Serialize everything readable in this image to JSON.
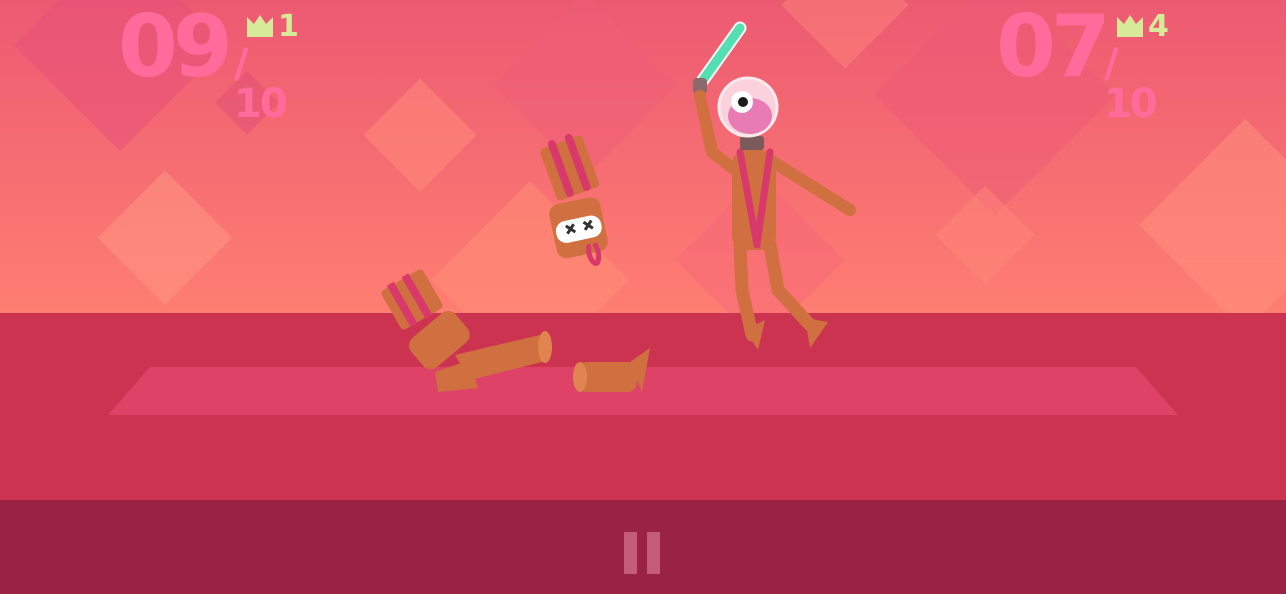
{
  "player1": {
    "score": "09",
    "total": "/ 10",
    "wins": "1"
  },
  "player2": {
    "score": "07",
    "total": "/ 10",
    "wins": "4"
  },
  "icons": {
    "crown": "crown-icon",
    "pause": "pause-icon"
  },
  "colors": {
    "sky": "#f06b72",
    "arena_floor": "#cc3350",
    "mat": "#df4267",
    "hud_bar": "#9a2345",
    "score_text": "#ff6c9c",
    "crown": "#d6ea9a",
    "lightsaber": "#54dfb2"
  }
}
